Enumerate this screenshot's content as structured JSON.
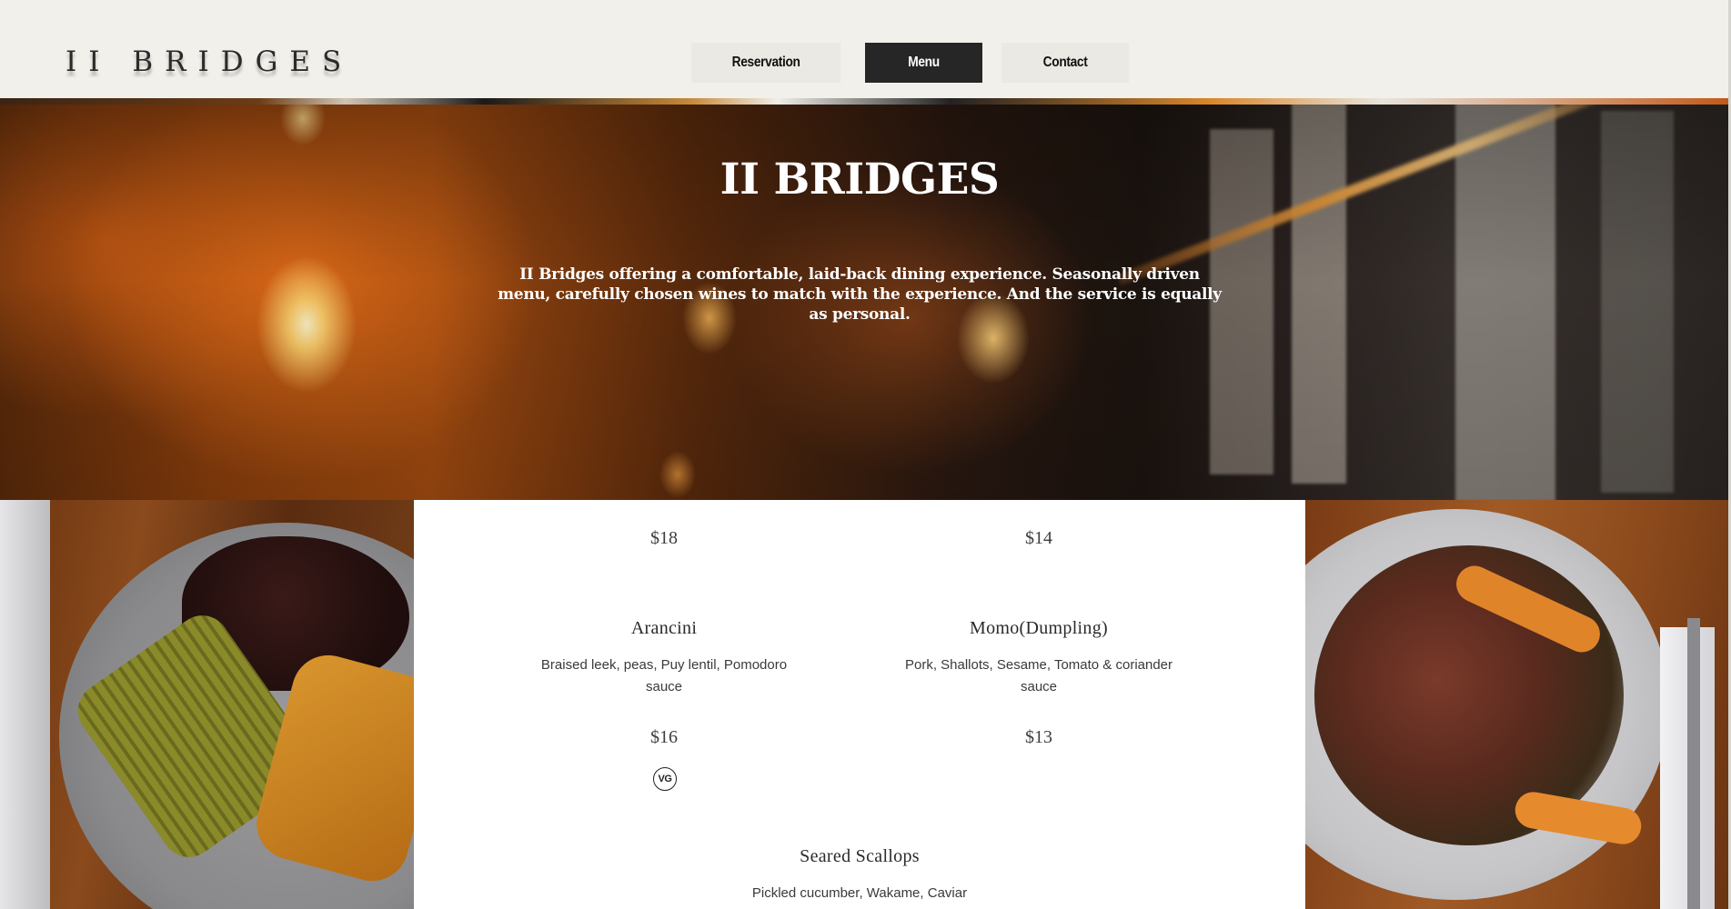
{
  "header": {
    "logo": "II BRIDGES",
    "nav": [
      {
        "label": "Reservation"
      },
      {
        "label": "Menu",
        "active": true
      },
      {
        "label": "Contact"
      }
    ]
  },
  "hero": {
    "title": "II BRIDGES",
    "tagline": "II Bridges offering a comfortable, laid-back dining experience. Seasonally driven menu, carefully chosen wines to match with the experience. And the service is equally as personal."
  },
  "menu": {
    "items": [
      {
        "price": "$18"
      },
      {
        "price": "$14"
      },
      {
        "name": "Arancini",
        "description": "Braised leek, peas, Puy lentil, Pomodoro sauce",
        "price": "$16",
        "badge": "VG"
      },
      {
        "name": "Momo(Dumpling)",
        "description": "Pork, Shallots, Sesame, Tomato & coriander sauce",
        "price": "$13"
      },
      {
        "name": "Seared Scallops",
        "description": "Pickled cucumber, Wakame, Caviar"
      }
    ]
  },
  "colors": {
    "header_bg": "#f2f0ea",
    "nav_active_bg": "#262626",
    "nav_bg": "#ebe9e3",
    "panel_bg": "#ffffff"
  }
}
